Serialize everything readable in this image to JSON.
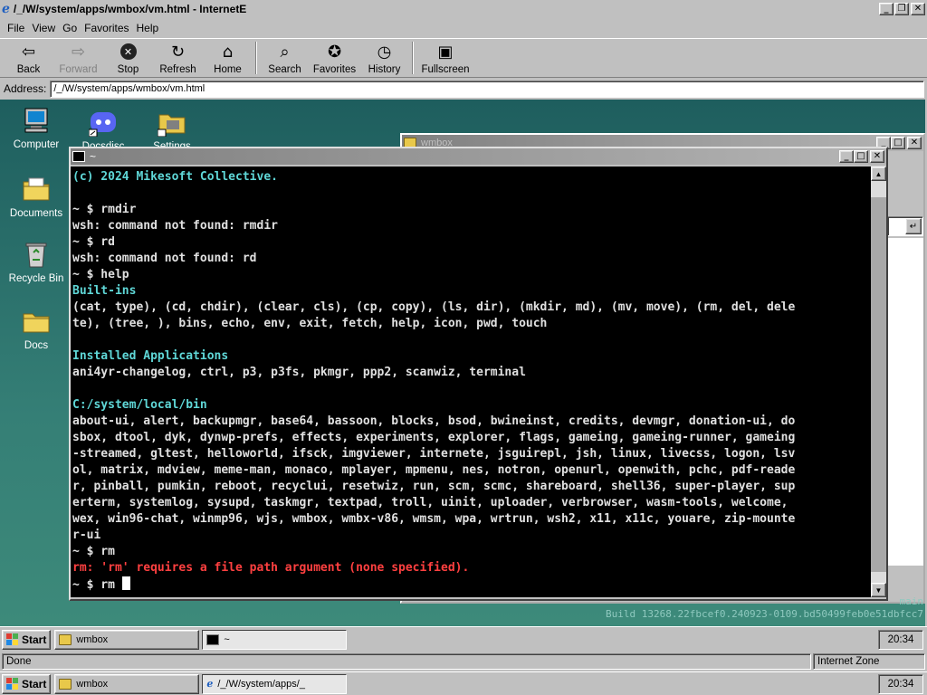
{
  "browser": {
    "title": "/_/W/system/apps/wmbox/vm.html - InternetE",
    "menu": [
      "File",
      "View",
      "Go",
      "Favorites",
      "Help"
    ],
    "toolbar": {
      "back": "Back",
      "forward": "Forward",
      "stop": "Stop",
      "refresh": "Refresh",
      "home": "Home",
      "search": "Search",
      "favorites": "Favorites",
      "history": "History",
      "fullscreen": "Fullscreen"
    },
    "address_label": "Address:",
    "address_value": "/_/W/system/apps/wmbox/vm.html",
    "status_left": "Done",
    "status_zone": "Internet Zone"
  },
  "desktop": {
    "icons": [
      {
        "label": "Computer"
      },
      {
        "label": "Docsdisc"
      },
      {
        "label": "Settings"
      },
      {
        "label": "Documents"
      },
      {
        "label": "Recycle Bin"
      },
      {
        "label": "Docs"
      }
    ],
    "watermark_line1": "main",
    "watermark_line2": "Build 13268.22fbcef0.240923-0109.bd50499feb0e51dbfcc7"
  },
  "wmbox_window": {
    "title": "wmbox"
  },
  "terminal": {
    "title": "~",
    "lines": [
      {
        "text": "(c) 2024 Mikesoft Collective.",
        "color": "cyan"
      },
      {
        "text": "",
        "color": "white"
      },
      {
        "text": "~ $ rmdir",
        "color": "white"
      },
      {
        "text": "wsh: command not found: rmdir",
        "color": "white"
      },
      {
        "text": "~ $ rd",
        "color": "white"
      },
      {
        "text": "wsh: command not found: rd",
        "color": "white"
      },
      {
        "text": "~ $ help",
        "color": "white"
      },
      {
        "text": "Built-ins",
        "color": "cyan"
      },
      {
        "text": "(cat, type), (cd, chdir), (clear, cls), (cp, copy), (ls, dir), (mkdir, md), (mv, move), (rm, del, dele",
        "color": "white"
      },
      {
        "text": "te), (tree, ), bins, echo, env, exit, fetch, help, icon, pwd, touch",
        "color": "white"
      },
      {
        "text": "",
        "color": "white"
      },
      {
        "text": "Installed Applications",
        "color": "cyan"
      },
      {
        "text": "ani4yr-changelog, ctrl, p3, p3fs, pkmgr, ppp2, scanwiz, terminal",
        "color": "white"
      },
      {
        "text": "",
        "color": "white"
      },
      {
        "text": "C:/system/local/bin",
        "color": "cyan"
      },
      {
        "text": "about-ui, alert, backupmgr, base64, bassoon, blocks, bsod, bwineinst, credits, devmgr, donation-ui, do",
        "color": "white"
      },
      {
        "text": "sbox, dtool, dyk, dynwp-prefs, effects, experiments, explorer, flags, gameing, gameing-runner, gameing",
        "color": "white"
      },
      {
        "text": "-streamed, gltest, helloworld, ifsck, imgviewer, internete, jsguirepl, jsh, linux, livecss, logon, lsv",
        "color": "white"
      },
      {
        "text": "ol, matrix, mdview, meme-man, monaco, mplayer, mpmenu, nes, notron, openurl, openwith, pchc, pdf-reade",
        "color": "white"
      },
      {
        "text": "r, pinball, pumkin, reboot, recyclui, resetwiz, run, scm, scmc, shareboard, shell36, super-player, sup",
        "color": "white"
      },
      {
        "text": "erterm, systemlog, sysupd, taskmgr, textpad, troll, uinit, uploader, verbrowser, wasm-tools, welcome,",
        "color": "white"
      },
      {
        "text": "wex, win96-chat, winmp96, wjs, wmbox, wmbx-v86, wmsm, wpa, wrtrun, wsh2, x11, x11c, youare, zip-mounte",
        "color": "white"
      },
      {
        "text": "r-ui",
        "color": "white"
      },
      {
        "text": "~ $ rm",
        "color": "white"
      },
      {
        "text": "rm: 'rm' requires a file path argument (none specified).",
        "color": "red"
      }
    ],
    "prompt_line": "~ $ rm "
  },
  "inner_taskbar": {
    "start": "Start",
    "tasks": [
      "wmbox",
      "~"
    ],
    "clock": "20:34"
  },
  "outer_taskbar": {
    "start": "Start",
    "tasks": [
      "wmbox",
      "/_/W/system/apps/_"
    ],
    "clock": "20:34"
  }
}
